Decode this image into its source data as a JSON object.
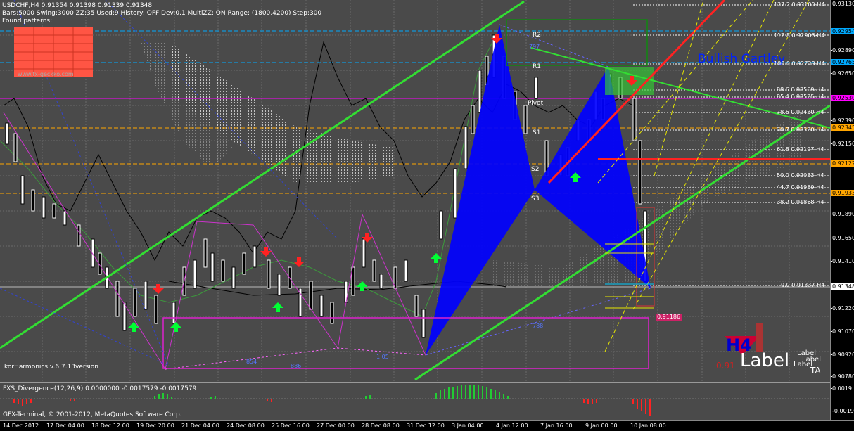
{
  "header": {
    "info_line": "USDCHF,H4  0.91354 0.91398 0.91339 0.91348",
    "settings_line": "Bars:5000  Swing:3000  ZZ:35  Used:9  History: OFF Dev:0.1  MultiZZ: ON  Range: (1800,4200)  Step:300",
    "found_patterns": "Found patterns:",
    "logo_text": "www.fx-geckko.com"
  },
  "labels": {
    "pattern_name": "Bullish Gartley",
    "indicator_version": "korHarmonics v.6.7.13version",
    "pivot_r2": "R2",
    "pivot_r1": "R1",
    "pivot_p": "Pivot",
    "pivot_s1": "S1",
    "pivot_s2": "S2",
    "pivot_s3": "S3",
    "timeframe": "H4",
    "big_label": "Label",
    "label_small_1": "Label",
    "label_small_2": "Label",
    "label_small_3": "Label",
    "label_small_4": "TA",
    "zz_797": "797",
    "zz_788": "788",
    "zz_854": "854",
    "zz_886": "886",
    "zz_105": "1.05",
    "red_price_box": "0.91186",
    "red_price_partial": "0.91"
  },
  "fib_levels": [
    {
      "text": "127.2  0.93100-H4"
    },
    {
      "text": "112.8  0.92906-H4"
    },
    {
      "text": "100.0  0.92728-H4"
    },
    {
      "text": "88.6  0.92569-H4"
    },
    {
      "text": "85.4  0.92525-H4"
    },
    {
      "text": "78.6  0.92430-H4"
    },
    {
      "text": "70.7  0.92320-H4"
    },
    {
      "text": "61.8  0.92197-H4"
    },
    {
      "text": "50.0  0.92033-H4"
    },
    {
      "text": "44.7  0.91959-H4"
    },
    {
      "text": "38.2  0.91868-H4"
    },
    {
      "text": "0.0  0.91337-H4"
    }
  ],
  "price_axis": {
    "labels": [
      "0.93130",
      "0.92890",
      "0.92650",
      "0.92390",
      "0.92150",
      "0.91890",
      "0.91650",
      "0.91410",
      "0.91220",
      "0.91070",
      "0.90920",
      "0.90780"
    ],
    "tags": [
      {
        "text": "0.92954",
        "color": "#00aaff"
      },
      {
        "text": "0.92765",
        "color": "#00aaff"
      },
      {
        "text": "0.92530",
        "color": "#ff00ff"
      },
      {
        "text": "0.92345",
        "color": "#ffa500"
      },
      {
        "text": "0.92122",
        "color": "#ffa500"
      },
      {
        "text": "0.91933",
        "color": "#ffa500"
      },
      {
        "text": "0.91348",
        "color": "#ffffff"
      }
    ]
  },
  "sub_indicator": {
    "title": "FXS_Divergence(12,26,9) 0.0000000 -0.0017579 -0.0017579",
    "axis": [
      "0.0019",
      "-0.0019"
    ]
  },
  "time_axis": {
    "labels": [
      "14 Dec 2012",
      "17 Dec 04:00",
      "18 Dec 12:00",
      "19 Dec 20:00",
      "21 Dec 04:00",
      "24 Dec 08:00",
      "25 Dec 16:00",
      "27 Dec 00:00",
      "28 Dec 08:00",
      "31 Dec 12:00",
      "3 Jan 04:00",
      "4 Jan 12:00",
      "7 Jan 16:00",
      "9 Jan 00:00",
      "10 Jan 08:00"
    ]
  },
  "copyright": "GFX-Terminal, © 2001-2012, MetaQuotes Software Corp.",
  "colors": {
    "background": "#4a4a4a",
    "channel": "#33dd33",
    "pattern_fill": "#0000ff",
    "trend_red": "#ff2222",
    "arrow_up": "#00ff33",
    "arrow_down": "#ff2222"
  }
}
